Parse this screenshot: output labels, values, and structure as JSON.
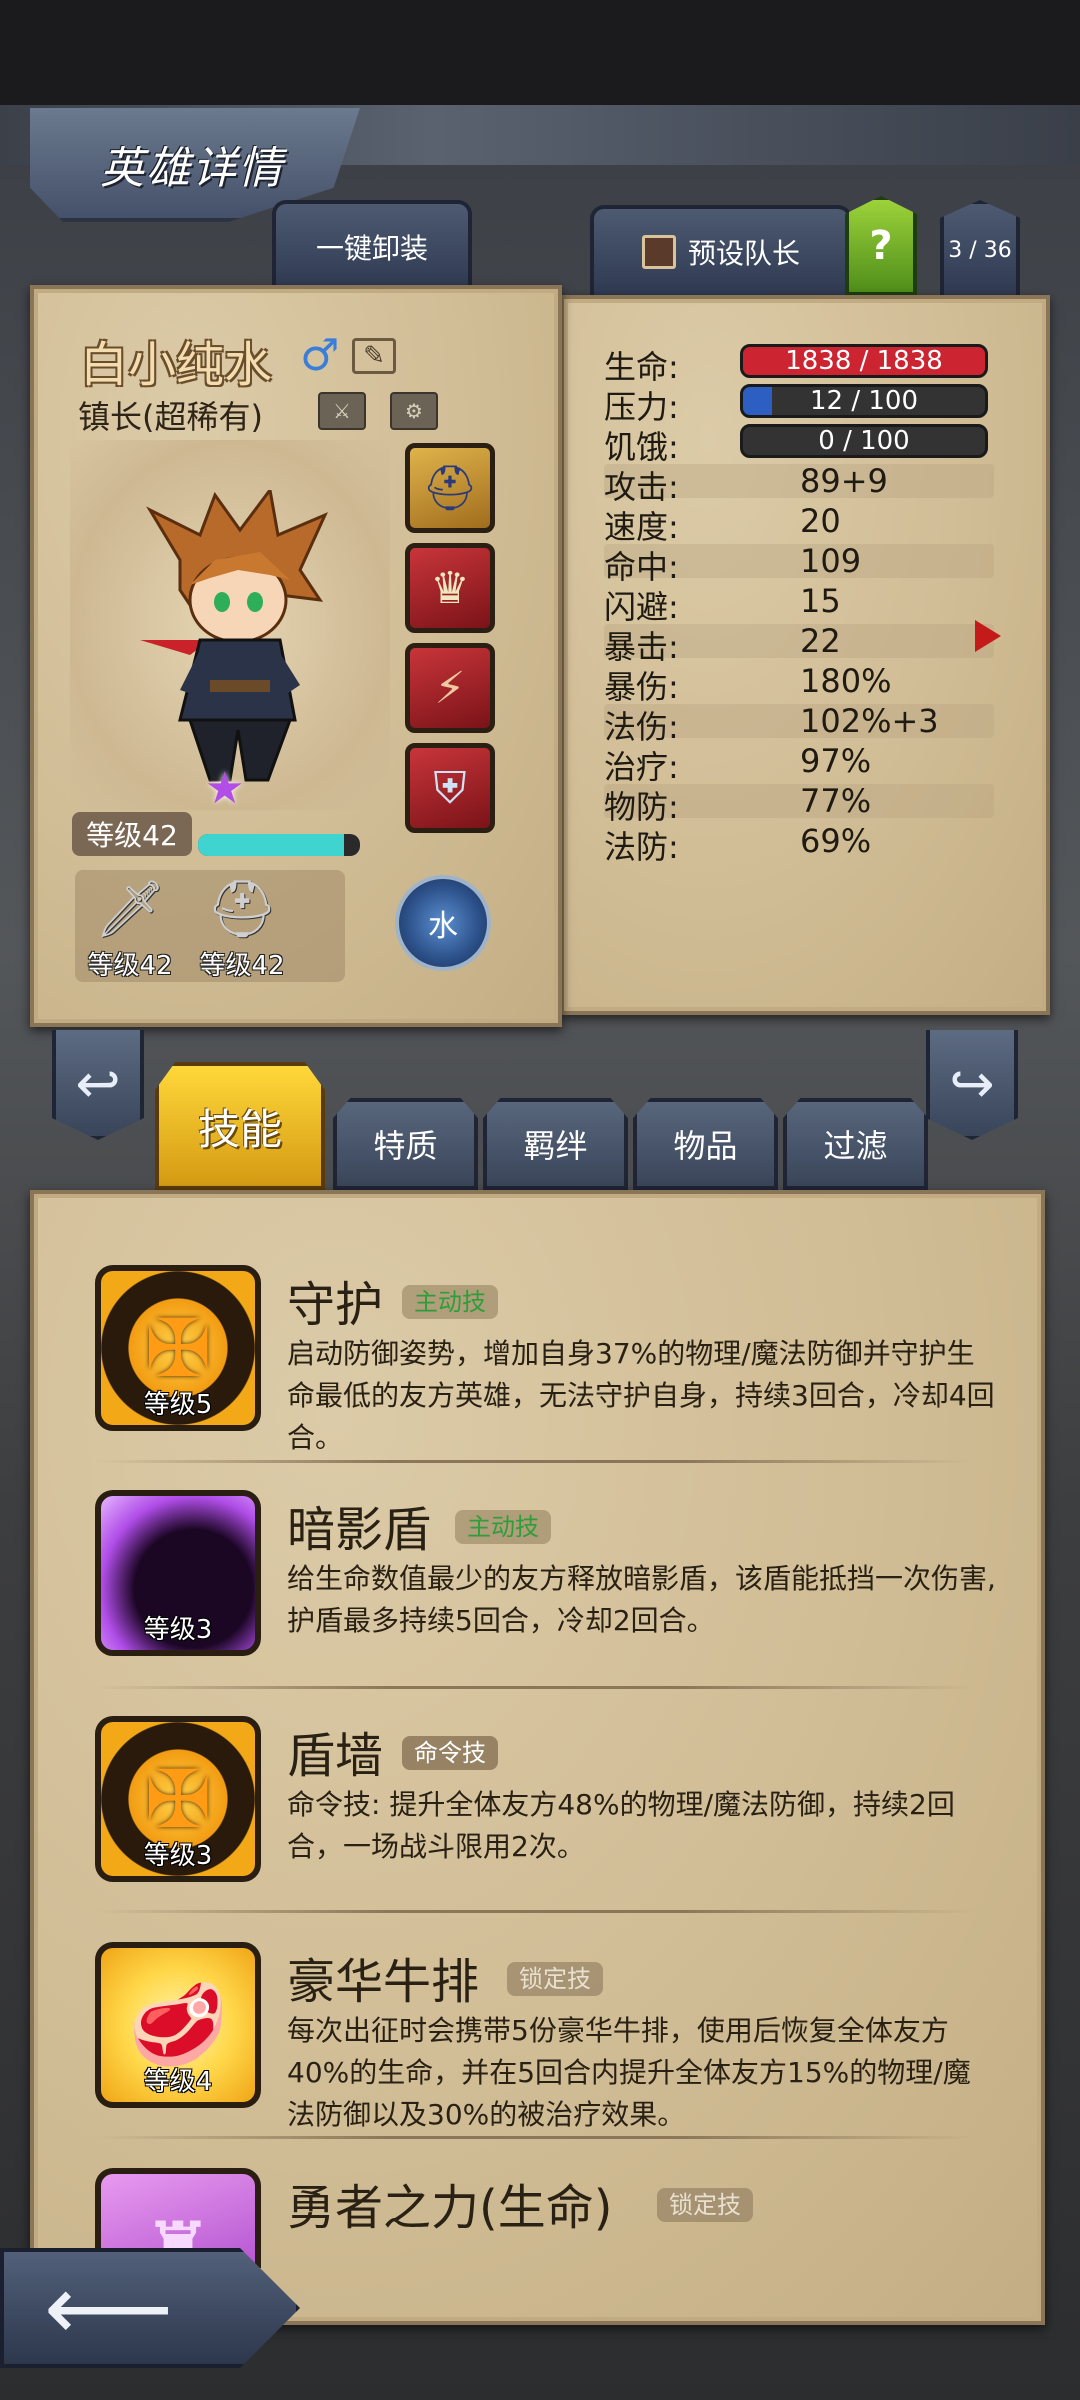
{
  "header": {
    "title": "英雄详情",
    "unequip_all": "一键卸装",
    "preset_captain": "预设队长",
    "help": "?",
    "hero_counter": "3 / 36"
  },
  "hero": {
    "name": "白小纯水",
    "gender_symbol": "♂",
    "class": "镇长(超稀有)",
    "level_label": "等级42",
    "xp_fraction": 0.9,
    "element": "水",
    "equipment": [
      {
        "icon": "helmet-icon",
        "rarity_color": "#d9a63a"
      },
      {
        "icon": "winged-helmet-icon",
        "rarity_color": "#b0202a"
      },
      {
        "icon": "bracer-icon",
        "rarity_color": "#b0202a"
      },
      {
        "icon": "armor-icon",
        "rarity_color": "#b0202a"
      }
    ],
    "gear": [
      {
        "icon": "sword-icon",
        "level": "等级42"
      },
      {
        "icon": "helmet-icon",
        "level": "等级42"
      }
    ]
  },
  "stats": {
    "bars": [
      {
        "label": "生命:",
        "text": "1838 / 1838",
        "fraction": 1.0,
        "color": "#cc2531"
      },
      {
        "label": "压力:",
        "text": "12 / 100",
        "fraction": 0.12,
        "color": "#2d5fc2"
      },
      {
        "label": "饥饿:",
        "text": "0 / 100",
        "fraction": 0.0,
        "color": "#555555"
      }
    ],
    "rows": [
      {
        "label": "攻击:",
        "value": "89+9"
      },
      {
        "label": "速度:",
        "value": "20"
      },
      {
        "label": "命中:",
        "value": "109"
      },
      {
        "label": "闪避:",
        "value": "15"
      },
      {
        "label": "暴击:",
        "value": "22"
      },
      {
        "label": "暴伤:",
        "value": "180%"
      },
      {
        "label": "法伤:",
        "value": "102%+3"
      },
      {
        "label": "治疗:",
        "value": "97%"
      },
      {
        "label": "物防:",
        "value": "77%"
      },
      {
        "label": "法防:",
        "value": "69%"
      }
    ]
  },
  "tabs": [
    {
      "label": "技能",
      "active": true
    },
    {
      "label": "特质",
      "active": false
    },
    {
      "label": "羁绊",
      "active": false
    },
    {
      "label": "物品",
      "active": false
    },
    {
      "label": "过滤",
      "active": false
    }
  ],
  "skills": [
    {
      "name": "守护",
      "tag": "主动技",
      "level": "等级5",
      "icon": "cross-shield-icon",
      "desc": "启动防御姿势，增加自身37%的物理/魔法防御并守护生命最低的友方英雄，无法守护自身，持续3回合，冷却4回合。"
    },
    {
      "name": "暗影盾",
      "tag": "主动技",
      "level": "等级3",
      "icon": "shadow-orb-icon",
      "desc": "给生命数值最少的友方释放暗影盾，该盾能抵挡一次伤害, 护盾最多持续5回合，冷却2回合。"
    },
    {
      "name": "盾墙",
      "tag": "命令技",
      "level": "等级3",
      "icon": "cross-shield-icon",
      "desc": "命令技: 提升全体友方48%的物理/魔法防御，持续2回合，一场战斗限用2次。"
    },
    {
      "name": "豪华牛排",
      "tag": "锁定技",
      "level": "等级4",
      "icon": "steak-icon",
      "desc": "每次出征时会携带5份豪华牛排，使用后恢复全体友方40%的生命，并在5回合内提升全体友方15%的物理/魔法防御以及30%的被治疗效果。"
    },
    {
      "name": "勇者之力(生命)",
      "tag": "锁定技",
      "level": "",
      "icon": "crystal-icon",
      "desc": ""
    }
  ]
}
